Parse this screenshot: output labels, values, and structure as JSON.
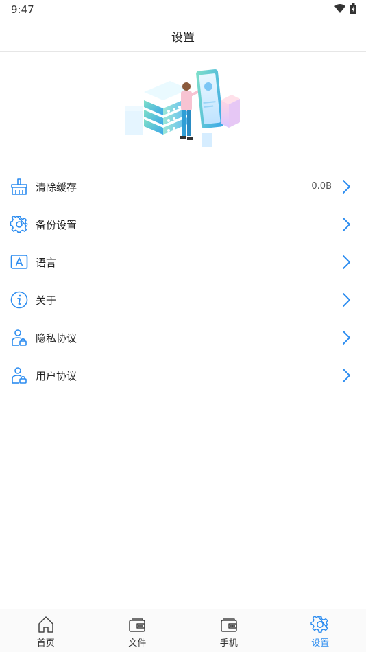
{
  "status_bar": {
    "time": "9:47"
  },
  "header": {
    "title": "设置"
  },
  "settings": {
    "items": [
      {
        "label": "清除缓存",
        "value": "0.0B",
        "icon": "broom-icon"
      },
      {
        "label": "备份设置",
        "icon": "gear-icon"
      },
      {
        "label": "语言",
        "icon": "language-icon"
      },
      {
        "label": "关于",
        "icon": "info-icon"
      },
      {
        "label": "隐私协议",
        "icon": "user-lock-icon"
      },
      {
        "label": "用户协议",
        "icon": "user-lock-icon"
      }
    ]
  },
  "tab_bar": {
    "tabs": [
      {
        "label": "首页",
        "icon": "home-icon",
        "active": false
      },
      {
        "label": "文件",
        "icon": "wallet-icon",
        "active": false
      },
      {
        "label": "手机",
        "icon": "wallet-icon",
        "active": false
      },
      {
        "label": "设置",
        "icon": "gear-icon",
        "active": true
      }
    ]
  },
  "colors": {
    "accent": "#2b8cf0",
    "text": "#222222",
    "divider": "#e6e6e6"
  }
}
